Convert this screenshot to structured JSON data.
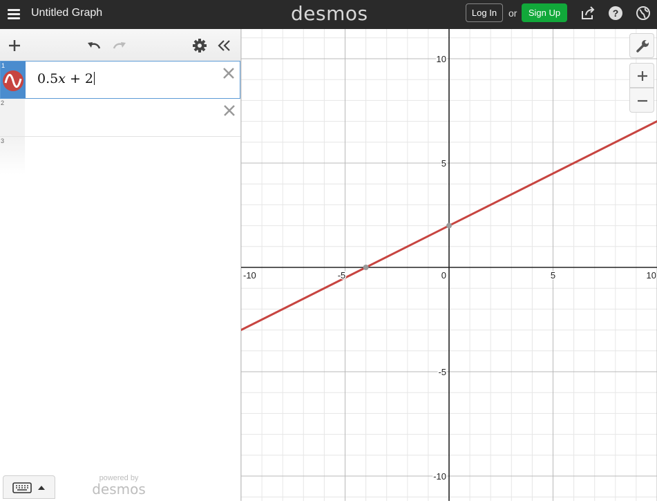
{
  "header": {
    "title": "Untitled Graph",
    "logo": "desmos",
    "login_label": "Log In",
    "or_label": "or",
    "signup_label": "Sign Up",
    "icons": [
      "menu-icon",
      "share-icon",
      "help-icon",
      "language-globe-icon"
    ],
    "signup_color": "#11a83a"
  },
  "expressions": [
    {
      "number": "1",
      "latex_parts": [
        "0.5",
        "x",
        " + 2"
      ],
      "color": "#c74440",
      "active": true
    },
    {
      "number": "2",
      "latex_parts": [
        "",
        "",
        ""
      ],
      "active": false
    },
    {
      "number": "3",
      "latex_parts": [
        "",
        "",
        ""
      ],
      "active": false
    }
  ],
  "footer": {
    "powered_by": "powered by",
    "brand": "desmos"
  },
  "graph": {
    "x_ticks": [
      "-10",
      "-5",
      "0",
      "5",
      "10"
    ],
    "y_ticks": [
      "10",
      "5",
      "-5",
      "-10"
    ],
    "curve_color": "#c74440"
  },
  "chart_data": {
    "type": "line",
    "series": [
      {
        "name": "0.5x + 2",
        "x": [
          -10,
          10
        ],
        "y": [
          -3,
          7
        ],
        "slope": 0.5,
        "intercept": 2
      }
    ],
    "points_of_interest": [
      {
        "x": -4,
        "y": 0
      },
      {
        "x": 0,
        "y": 2
      }
    ],
    "xlim": [
      -10,
      10
    ],
    "ylim": [
      -11,
      11
    ],
    "grid": true
  }
}
